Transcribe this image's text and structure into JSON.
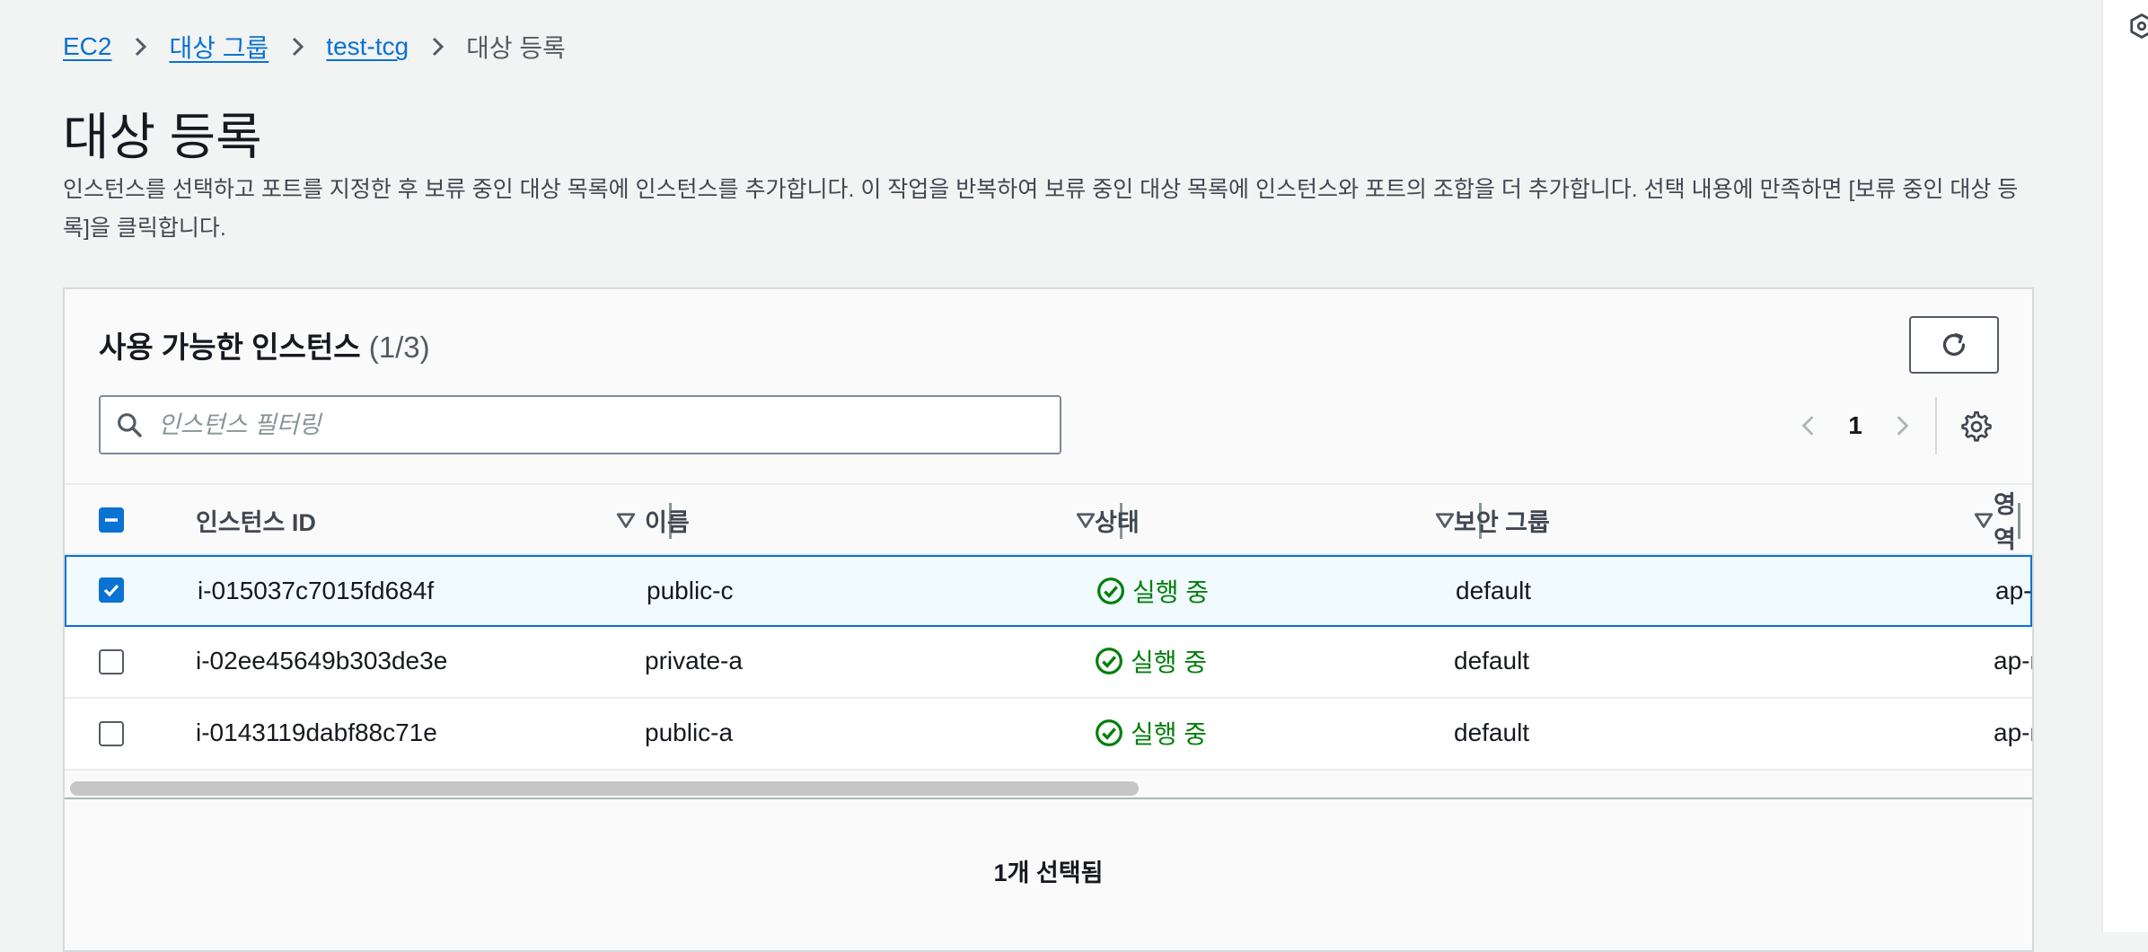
{
  "breadcrumb": {
    "items": [
      "EC2",
      "대상 그룹",
      "test-tcg"
    ],
    "current": "대상 등록"
  },
  "page": {
    "title": "대상 등록",
    "description": "인스턴스를 선택하고 포트를 지정한 후 보류 중인 대상 목록에 인스턴스를 추가합니다. 이 작업을 반복하여 보류 중인 대상 목록에 인스턴스와 포트의 조합을 더 추가합니다. 선택 내용에 만족하면 [보류 중인 대상 등록]을 클릭합니다."
  },
  "panel": {
    "title": "사용 가능한 인스턴스",
    "count": "(1/3)",
    "search_placeholder": "인스턴스 필터링",
    "current_page": "1",
    "columns": [
      "인스턴스 ID",
      "이름",
      "상태",
      "보안 그룹",
      "영역"
    ],
    "rows": [
      {
        "checked": true,
        "instance_id": "i-015037c7015fd684f",
        "name": "public-c",
        "state": "실행 중",
        "security_group": "default",
        "zone": "ap-n"
      },
      {
        "checked": false,
        "instance_id": "i-02ee45649b303de3e",
        "name": "private-a",
        "state": "실행 중",
        "security_group": "default",
        "zone": "ap-n"
      },
      {
        "checked": false,
        "instance_id": "i-0143119dabf88c71e",
        "name": "public-a",
        "state": "실행 중",
        "security_group": "default",
        "zone": "ap-n"
      }
    ],
    "selected_summary": "1개 선택됨"
  },
  "icons": {
    "breadcrumb_sep": "chevron-right-icon",
    "refresh": "refresh-icon",
    "search": "search-icon",
    "settings": "gear-icon",
    "status": "check-circle-icon",
    "sort": "sort-down-icon",
    "side": "side-panel-icon"
  },
  "colors": {
    "link": "#0972d3",
    "success": "#037f0c",
    "selected_bg": "#f1faff",
    "selected_border": "#0972d3"
  }
}
